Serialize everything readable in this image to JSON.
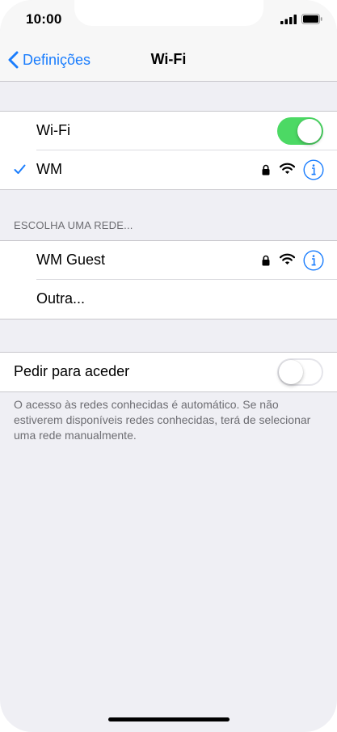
{
  "status_bar": {
    "time": "10:00",
    "signal_icon": "cellular-signal-icon",
    "battery_icon": "battery-icon"
  },
  "nav": {
    "back_label": "Definições",
    "back_icon": "chevron-left-icon",
    "title": "Wi-Fi"
  },
  "wifi": {
    "label": "Wi-Fi",
    "enabled": true,
    "connected_network": {
      "name": "WM",
      "selected_icon": "checkmark-icon",
      "secured": true,
      "icons": [
        "lock-icon",
        "wifi-signal-icon",
        "info-icon"
      ]
    }
  },
  "networks": {
    "header": "ESCOLHA UMA REDE...",
    "items": [
      {
        "name": "WM Guest",
        "secured": true,
        "icons": [
          "lock-icon",
          "wifi-signal-icon",
          "info-icon"
        ]
      },
      {
        "name": "Outra..."
      }
    ]
  },
  "ask_to_join": {
    "label": "Pedir para aceder",
    "enabled": false,
    "footer": "O acesso às redes conhecidas é automático. Se não estiverem disponíveis redes conhecidas, terá de selecionar uma rede manualmente."
  },
  "colors": {
    "accent": "#1a7dfd",
    "toggle_on": "#4cd964",
    "background": "#efeff4",
    "secondary_text": "#6d6d72"
  }
}
